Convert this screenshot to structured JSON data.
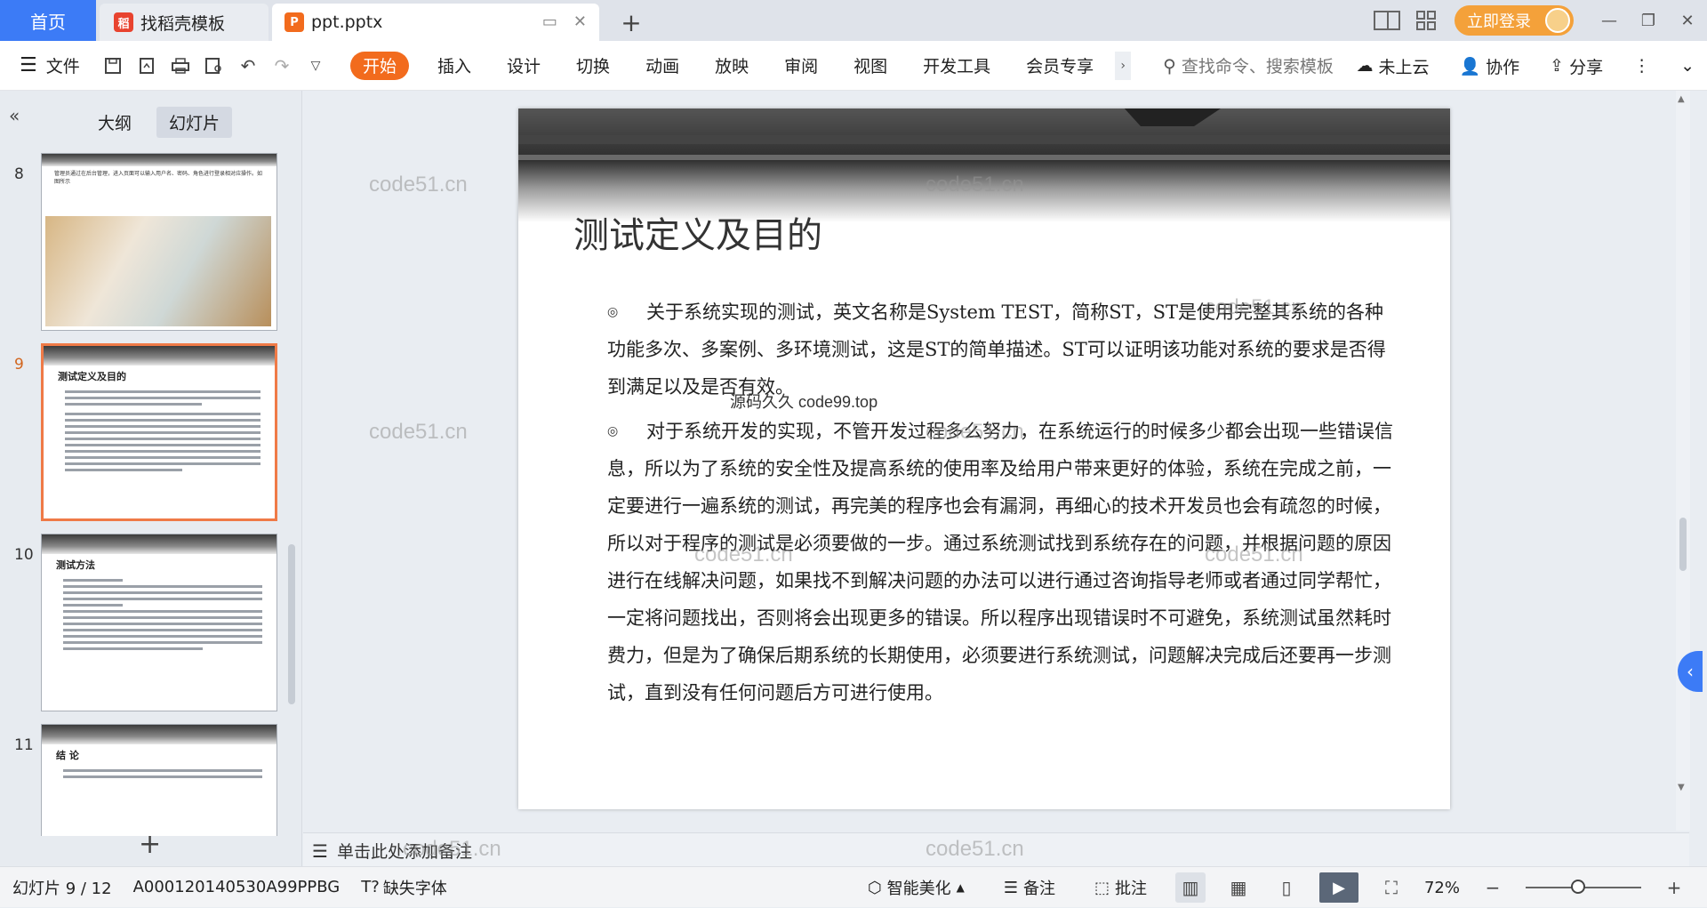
{
  "tabs": {
    "home": "首页",
    "templates": "找稻壳模板",
    "doc": "ppt.pptx",
    "doc_icon_glyph": "P",
    "templates_icon_glyph": "稻"
  },
  "window": {
    "login": "立即登录"
  },
  "toolbar": {
    "file": "文件",
    "menu_tabs": [
      "开始",
      "插入",
      "设计",
      "切换",
      "动画",
      "放映",
      "审阅",
      "视图",
      "开发工具",
      "会员专享"
    ],
    "search_placeholder": "查找命令、搜索模板",
    "cloud": "未上云",
    "collab": "协作",
    "share": "分享",
    "accent": "#f26b1d"
  },
  "left_panel": {
    "view_tabs": [
      "大纲",
      "幻灯片"
    ],
    "thumbs": [
      {
        "num": "8",
        "kind": "image",
        "text": "管理员通过在后台管理，进入页面可以输入用户名、密码、角色进行登录相对应操作。如图所示"
      },
      {
        "num": "9",
        "kind": "text",
        "title": "测试定义及目的",
        "selected": true
      },
      {
        "num": "10",
        "kind": "text",
        "title": "测试方法"
      },
      {
        "num": "11",
        "kind": "text",
        "title": "结 论"
      }
    ]
  },
  "slide": {
    "title": "测试定义及目的",
    "bullet_glyph": "◎",
    "paragraphs": [
      "关于系统实现的测试，英文名称是System TEST，简称ST，ST是使用完整其系统的各种功能多次、多案例、多环境测试，这是ST的简单描述。ST可以证明该功能对系统的要求是否得到满足以及是否有效。",
      "对于系统开发的实现，不管开发过程多么努力，在系统运行的时候多少都会出现一些错误信息，所以为了系统的安全性及提高系统的使用率及给用户带来更好的体验，系统在完成之前，一定要进行一遍系统的测试，再完美的程序也会有漏洞，再细心的技术开发员也会有疏忽的时候，所以对于程序的测试是必须要做的一步。通过系统测试找到系统存在的问题，并根据问题的原因进行在线解决问题，如果找不到解决问题的办法可以进行通过咨询指导老师或者通过同学帮忙，一定将问题找出，否则将会出现更多的错误。所以程序出现错误时不可避免，系统测试虽然耗时费力，但是为了确保后期系统的长期使用，必须要进行系统测试，问题解决完成后还要再一步测试，直到没有任何问题后方可进行使用。"
    ],
    "center_watermark": "源码久久 code99.top"
  },
  "watermark": "code51.cn",
  "notes": "单击此处添加备注",
  "status": {
    "slide_counter": "幻灯片 9 / 12",
    "doc_id": "A000120140530A99PPBG",
    "missing_font": "缺失字体",
    "beautify": "智能美化",
    "notes_btn": "备注",
    "comment_btn": "批注",
    "zoom": "72%",
    "zoom_fraction": 0.45
  }
}
